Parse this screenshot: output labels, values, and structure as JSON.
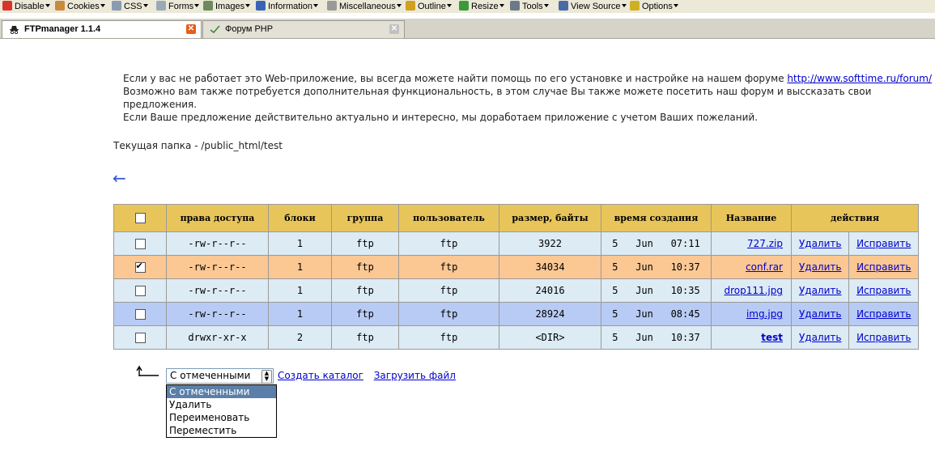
{
  "toolbar": {
    "items": [
      {
        "label": "Disable",
        "icon": "disable-icon",
        "color": "#d9342b"
      },
      {
        "label": "Cookies",
        "icon": "cookies-icon",
        "color": "#c98a3a"
      },
      {
        "label": "CSS",
        "icon": "css-icon",
        "color": "#8a9bb0"
      },
      {
        "label": "Forms",
        "icon": "forms-icon",
        "color": "#9aa8b8"
      },
      {
        "label": "Images",
        "icon": "images-icon",
        "color": "#6d8a5c"
      },
      {
        "label": "Information",
        "icon": "information-icon",
        "color": "#3a63b8"
      },
      {
        "label": "Miscellaneous",
        "icon": "miscellaneous-icon",
        "color": "#9a9a9a"
      },
      {
        "label": "Outline",
        "icon": "outline-icon",
        "color": "#d0a020"
      },
      {
        "label": "Resize",
        "icon": "resize-icon",
        "color": "#3a9a3a"
      },
      {
        "label": "Tools",
        "icon": "tools-icon",
        "color": "#6a7a8a"
      },
      {
        "label": "View Source",
        "icon": "view-source-icon",
        "color": "#4a6aa8"
      },
      {
        "label": "Options",
        "icon": "options-icon",
        "color": "#d0b020"
      }
    ]
  },
  "tabs": [
    {
      "label": "FTPmanager 1.1.4",
      "icon": "spy-icon",
      "close_color": "#e85c1a"
    },
    {
      "label": "Форум PHP",
      "icon": "check-icon",
      "close_color": "#c0c0c0"
    }
  ],
  "info": {
    "line1": "Если у вас не работает это Web-приложение, вы всегда можете найти помощь по его установке и настройке на нашем форуме ",
    "link": "http://www.softtime.ru/forum/",
    "line2": "Возможно вам также потребуется дополнительная функциональность, в этом случае Вы также можете посетить наш форум и выссказать свои предложения.",
    "line3": "Если Ваше предложение действительно актуально и интересно, мы доработаем приложение с учетом Ваших пожеланий."
  },
  "folder": "Текущая папка - /public_html/test",
  "back_arrow": "←",
  "table": {
    "headers": [
      "права доступа",
      "блоки",
      "группа",
      "пользователь",
      "размер, байты",
      "время создания",
      "Название",
      "действия"
    ],
    "rows": [
      {
        "checked": false,
        "perm": "-rw-r--r--",
        "blocks": "1",
        "group": "ftp",
        "user": "ftp",
        "size": "3922",
        "day": "5",
        "month": "Jun",
        "time": "07:11",
        "name": "727.zip",
        "style": "light",
        "bold": false
      },
      {
        "checked": true,
        "perm": "-rw-r--r--",
        "blocks": "1",
        "group": "ftp",
        "user": "ftp",
        "size": "34034",
        "day": "5",
        "month": "Jun",
        "time": "10:37",
        "name": "conf.rar",
        "style": "orange",
        "bold": false
      },
      {
        "checked": false,
        "perm": "-rw-r--r--",
        "blocks": "1",
        "group": "ftp",
        "user": "ftp",
        "size": "24016",
        "day": "5",
        "month": "Jun",
        "time": "10:35",
        "name": "drop111.jpg",
        "style": "light",
        "bold": false
      },
      {
        "checked": false,
        "perm": "-rw-r--r--",
        "blocks": "1",
        "group": "ftp",
        "user": "ftp",
        "size": "28924",
        "day": "5",
        "month": "Jun",
        "time": "08:45",
        "name": "img.jpg",
        "style": "blue",
        "bold": false
      },
      {
        "checked": false,
        "perm": "drwxr-xr-x",
        "blocks": "2",
        "group": "ftp",
        "user": "ftp",
        "size": "<DIR>",
        "day": "5",
        "month": "Jun",
        "time": "10:37",
        "name": "test",
        "style": "light",
        "bold": true
      }
    ],
    "delete_label": "Удалить",
    "edit_label": "Исправить"
  },
  "bottom": {
    "select_value": "С отмеченными",
    "create_dir": "Создать каталог",
    "upload": "Загрузить файл",
    "options": [
      "С отмеченными",
      "Удалить",
      "Переименовать",
      "Переместить"
    ]
  }
}
